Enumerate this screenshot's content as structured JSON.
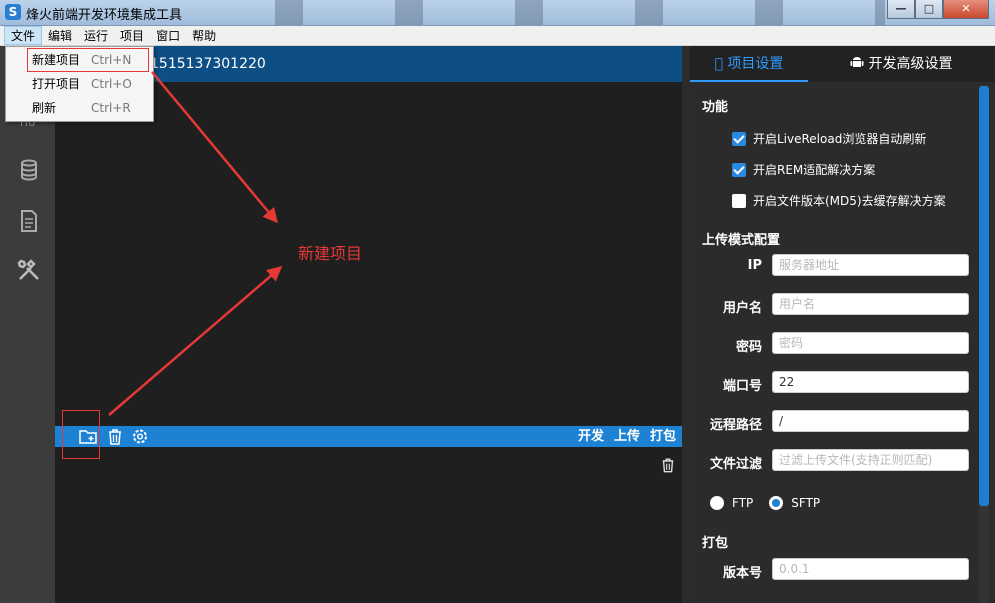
{
  "window": {
    "title": "烽火前端开发环境集成工具",
    "app_icon": "S",
    "min_glyph": "—",
    "max_glyph": "□",
    "close_glyph": "✕"
  },
  "menubar": [
    "文件",
    "编辑",
    "运行",
    "项目",
    "窗口",
    "帮助"
  ],
  "file_menu": [
    {
      "label": "新建项目",
      "shortcut": "Ctrl+N"
    },
    {
      "label": "打开项目",
      "shortcut": "Ctrl+O"
    },
    {
      "label": "刷新",
      "shortcut": "Ctrl+R"
    }
  ],
  "sidebar": {
    "items": [
      "logo-icon",
      "database-icon",
      "document-icon",
      "tools-icon"
    ],
    "logo_text": "iYo"
  },
  "project": {
    "name": "1515137301220"
  },
  "toolbar": {
    "actions": [
      "开发",
      "上传",
      "打包"
    ]
  },
  "right_panel": {
    "tabs": [
      "项目设置",
      "开发高级设置"
    ],
    "section_function": "功能",
    "checkboxes": [
      {
        "label": "开启LiveReload浏览器自动刷新",
        "checked": true
      },
      {
        "label": "开启REM适配解决方案",
        "checked": true
      },
      {
        "label": "开启文件版本(MD5)去缓存解决方案",
        "checked": false
      }
    ],
    "section_upload": "上传模式配置",
    "fields": [
      {
        "label": "IP",
        "value": "",
        "placeholder": "服务器地址"
      },
      {
        "label": "用户名",
        "value": "",
        "placeholder": "用户名"
      },
      {
        "label": "密码",
        "value": "",
        "placeholder": "密码"
      },
      {
        "label": "端口号",
        "value": "22",
        "placeholder": ""
      },
      {
        "label": "远程路径",
        "value": "/",
        "placeholder": ""
      },
      {
        "label": "文件过滤",
        "value": "",
        "placeholder": "过滤上传文件(支持正则匹配)"
      }
    ],
    "protocols": [
      {
        "label": "FTP",
        "selected": false
      },
      {
        "label": "SFTP",
        "selected": true
      }
    ],
    "section_pack": "打包",
    "version": {
      "label": "版本号",
      "value": "",
      "placeholder": "0.0.1"
    }
  },
  "annotation": {
    "text": "新建项目"
  },
  "colors": {
    "accent": "#1d82d4",
    "header": "#0d4f85",
    "annotation": "#e53935"
  }
}
